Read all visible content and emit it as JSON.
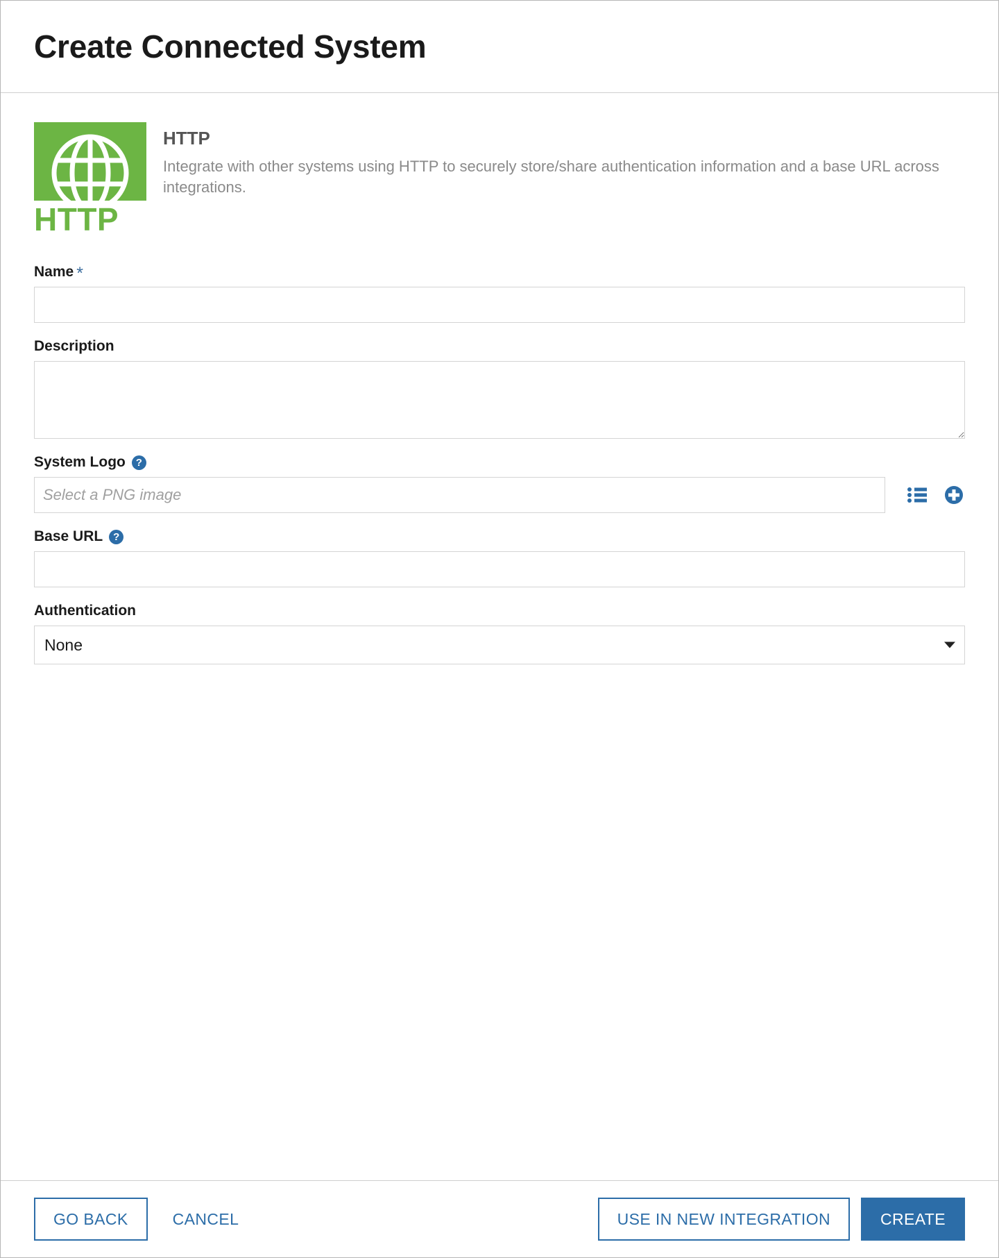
{
  "window": {
    "title": "Create Connected System"
  },
  "system": {
    "logo_icon": "globe-icon",
    "logo_wordmark": "HTTP",
    "name": "HTTP",
    "description": "Integrate with other systems using HTTP to securely store/share authentication information and a base URL across integrations.",
    "logo_color": "#6cb544"
  },
  "form": {
    "name_field": {
      "label": "Name",
      "required_marker": "*",
      "value": "",
      "placeholder": ""
    },
    "description_field": {
      "label": "Description",
      "value": "",
      "placeholder": ""
    },
    "system_logo_field": {
      "label": "System Logo",
      "help_icon": "?",
      "value": "",
      "placeholder": "Select a PNG image",
      "browse_icon": "list-icon",
      "add_icon": "plus-circle-icon"
    },
    "base_url_field": {
      "label": "Base URL",
      "help_icon": "?",
      "value": "",
      "placeholder": ""
    },
    "authentication_field": {
      "label": "Authentication",
      "selected": "None",
      "caret_icon": "chevron-down-icon"
    }
  },
  "footer": {
    "go_back_label": "GO BACK",
    "cancel_label": "CANCEL",
    "use_in_new_integration_label": "USE IN NEW INTEGRATION",
    "create_label": "CREATE"
  },
  "colors": {
    "accent": "#2c6da8",
    "brand_green": "#6cb544",
    "required": "#3d6e9e"
  }
}
